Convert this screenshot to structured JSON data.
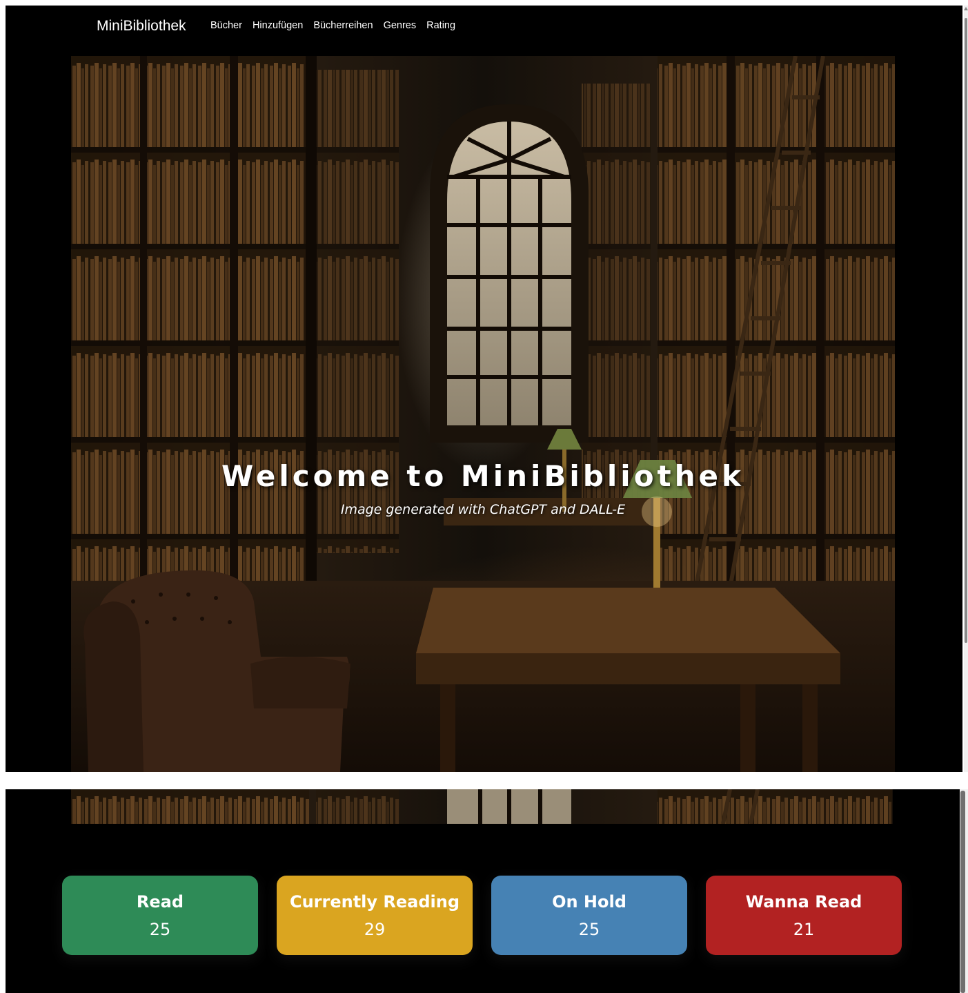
{
  "navbar": {
    "brand": "MiniBibliothek",
    "links": [
      "Bücher",
      "Hinzufügen",
      "Bücherreihen",
      "Genres",
      "Rating"
    ]
  },
  "hero": {
    "title": "Welcome to MiniBibliothek",
    "caption": "Image generated with ChatGPT and DALL-E"
  },
  "status_cards": [
    {
      "label": "Read",
      "count": "25",
      "color": "#2e8b57"
    },
    {
      "label": "Currently Reading",
      "count": "29",
      "color": "#daa520"
    },
    {
      "label": "On Hold",
      "count": "25",
      "color": "#4682b4"
    },
    {
      "label": "Wanna Read",
      "count": "21",
      "color": "#b22222"
    }
  ]
}
